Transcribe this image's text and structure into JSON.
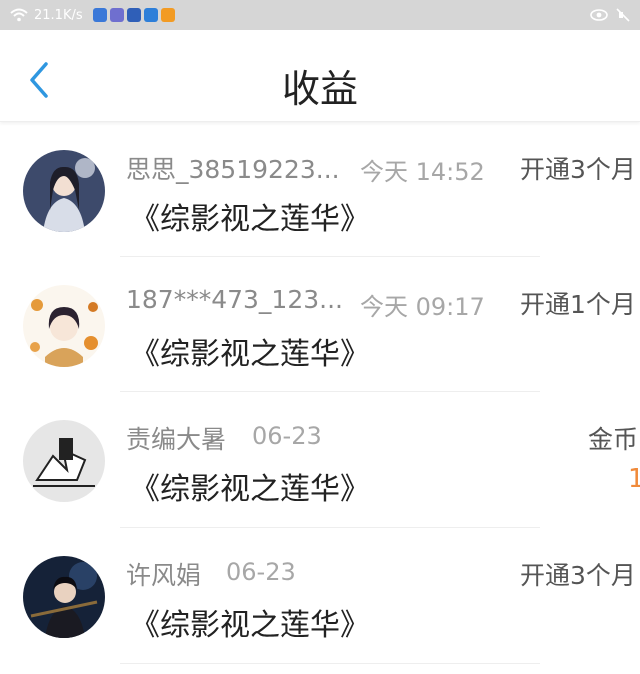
{
  "status_bar": {
    "speed": "21.1K/s",
    "app_icons": [
      "#3a78d8",
      "#6f6fcf",
      "#2f5fb8",
      "#2e7fd9",
      "#f29b24"
    ]
  },
  "nav": {
    "title": "收益",
    "back_icon": "chevron-left-icon",
    "accent": "#2f97e0"
  },
  "records": [
    {
      "name": "思思_38519223...",
      "time": "今天 14:52",
      "book": "《综影视之莲华》",
      "type": "开通3个月",
      "amount": ""
    },
    {
      "name": "187***473_123...",
      "time": "今天 09:17",
      "book": "《综影视之莲华》",
      "type": "开通1个月",
      "amount": ""
    },
    {
      "name": "责编大暑",
      "time": "06-23",
      "book": "《综影视之莲华》",
      "type": "金币",
      "amount": "1"
    },
    {
      "name": "许风娟",
      "time": "06-23",
      "book": "《综影视之莲华》",
      "type": "开通3个月",
      "amount": ""
    }
  ]
}
